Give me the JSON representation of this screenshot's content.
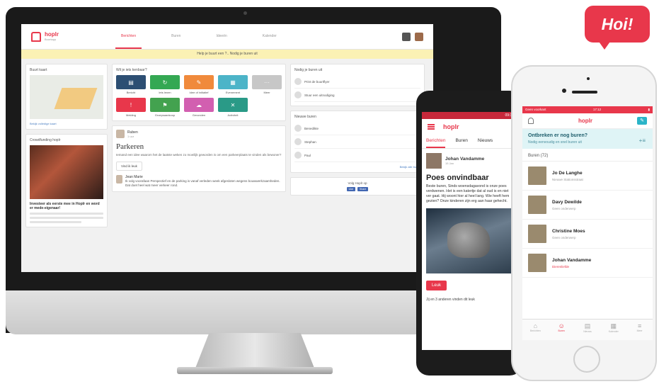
{
  "hoi": "Hoi!",
  "desktop": {
    "logo": "hoplr",
    "logo_sub": "Buurtapp",
    "tabs": [
      "Berichten",
      "Buren",
      "Ideeën",
      "Kalender"
    ],
    "banner_text": "Help je buurt een ?.. Nodig je buren uit",
    "map_title": "Buurt kaart",
    "map_link": "Bekijk volledige kaart",
    "crowd_title": "Crowdfunding hoplr",
    "crowd_text": "Investeer als eerste mee in Hoplr en word er mede-eigenaar!",
    "compose_title": "Wil je iets kenbaar?",
    "tiles": [
      {
        "label": "Bericht",
        "color": "#2d4f73",
        "glyph": "▤"
      },
      {
        "label": "Iets lenen",
        "color": "#34a853",
        "glyph": "↻"
      },
      {
        "label": "Idee of initiatief",
        "color": "#f08a3c",
        "glyph": "✎"
      },
      {
        "label": "Evenement",
        "color": "#4cb4c8",
        "glyph": "▦"
      },
      {
        "label": "Meer",
        "color": "#c7c7c7",
        "glyph": "···"
      },
      {
        "label": "Melding",
        "color": "#e8374b",
        "glyph": "!"
      },
      {
        "label": "Groepsaankoop",
        "color": "#43a24f",
        "glyph": "⚑"
      },
      {
        "label": "Gevonden",
        "color": "#d25fb0",
        "glyph": "☁"
      },
      {
        "label": "Activiteit",
        "color": "#2a9a87",
        "glyph": "✕"
      }
    ],
    "post": {
      "author": "Ruben",
      "time": "1 uur",
      "title": "Parkeren",
      "body": "Iemand een idee waarom het de laatste weken zo moeilijk geworden is om een parkeerplaats te vinden als bewoner?",
      "like": "Vind ik leuk",
      "reply_author": "Jean Marie",
      "reply_body": "Ik volg voorafaan Perspectief en de parking is vanaf verleden week afgesloten wegens bouwwerkzaamheden. Dat doet heel wat meer verkeer rond."
    },
    "invite_title": "Nodig je buren uit",
    "notifications": [
      "Print de buurtflyer",
      "Stuur een uitnodiging"
    ],
    "neighbours_title": "Nieuwe buren",
    "neighbours": [
      "Benedikte",
      "Stephan",
      "Paul"
    ],
    "neighbours_link": "Bekijk alle buren",
    "like_label": "Volg Hoplr op",
    "fb_like": "Like",
    "fb_share": "Share"
  },
  "android": {
    "status": "09:31",
    "logo": "hoplr",
    "tabs": [
      "Berichten",
      "Buren",
      "Nieuws"
    ],
    "author": "Johan Vandamme",
    "date": "15 Jan",
    "title": "Poes onvindbaar",
    "body": "Beste buren, Sinds woensdagavond is onze poes verdwenen. Het is een katertje dat al oud is en niet ver gaat. Hij woont hier al heel lang. Wie heeft hem gezien? Onze kinderen zijn erg aan haar gehecht.",
    "like_button": "Leuk",
    "likes_text": "Jij en 3 anderen vinden dit leuk"
  },
  "iphone": {
    "status_left": "Geen voorkant",
    "status_time": "17:12",
    "logo": "hoplr",
    "promo_title": "Ontbreken er nog buren?",
    "promo_sub": "Nodig eenvoudig en snel buren uit",
    "section": "Buren (72)",
    "people": [
      {
        "name": "Jo De Langhe",
        "sub": "Nieuwe Stationsstraat",
        "red": false
      },
      {
        "name": "Davy Dewilde",
        "sub": "Geen onderwerp",
        "red": false
      },
      {
        "name": "Christine Moes",
        "sub": "Geen onderwerp",
        "red": false
      },
      {
        "name": "Johan Vandamme",
        "sub": "Dierenliefde",
        "red": true
      }
    ],
    "tabbar": [
      "Berichten",
      "Buren",
      "Nieuws",
      "Kalender",
      "Meer"
    ]
  }
}
